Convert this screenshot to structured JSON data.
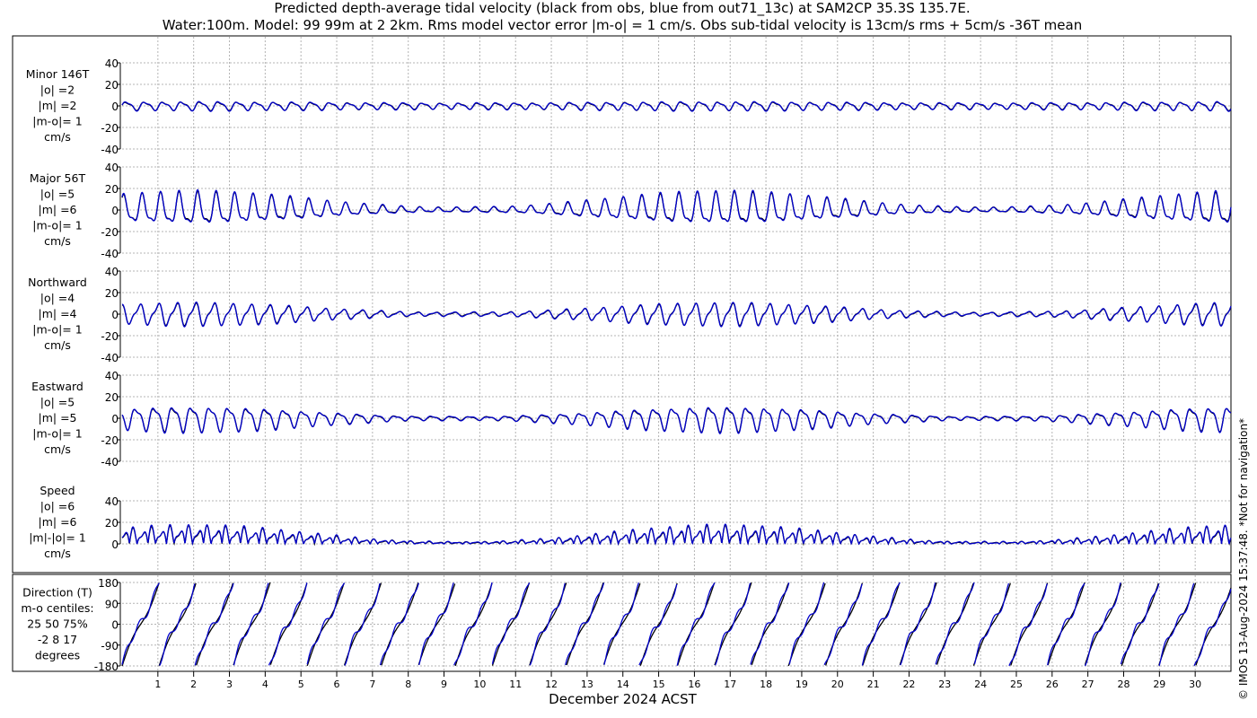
{
  "title_line1": "Predicted depth-average tidal velocity (black from obs, blue from out71_13c) at SAM2CP 35.3S 135.7E.",
  "title_line2": "Water:100m. Model: 99 99m at 2 2km. Rms model vector error |m-o| = 1 cm/s. Obs sub-tidal velocity is 13cm/s rms + 5cm/s -36T mean",
  "side_note": "© IMOS 13-Aug-2024 15:37:48. *Not for navigation*",
  "colors": {
    "obs": "#000000",
    "model": "#0000cc",
    "grid": "#b4b4b4",
    "axis": "#000000"
  },
  "chart_data": [
    {
      "type": "line",
      "id": "minor",
      "label_lines": [
        "Minor 146T",
        "|o| =2",
        "|m| =2",
        "|m-o|= 1",
        "cm/s"
      ],
      "ylim": [
        -40,
        40
      ],
      "yticks": [
        40,
        20,
        0,
        -20,
        -40
      ],
      "series": [
        {
          "name": "black from obs"
        },
        {
          "name": "blue from out71_13c"
        }
      ],
      "amplitude_envelope": [
        2.5,
        3.5
      ],
      "mean": 0
    },
    {
      "type": "line",
      "id": "major",
      "label_lines": [
        "Major 56T",
        "|o| =5",
        "|m| =6",
        "|m-o|= 1",
        "cm/s"
      ],
      "ylim": [
        -40,
        40
      ],
      "yticks": [
        40,
        20,
        0,
        -20,
        -40
      ],
      "series": [
        {
          "name": "black from obs"
        },
        {
          "name": "blue from out71_13c"
        }
      ],
      "amplitude_envelope": [
        2,
        13
      ],
      "mean": 0
    },
    {
      "type": "line",
      "id": "northward",
      "label_lines": [
        "Northward",
        "|o| =4",
        "|m| =4",
        "|m-o|= 1",
        "cm/s"
      ],
      "ylim": [
        -40,
        40
      ],
      "yticks": [
        40,
        20,
        0,
        -20,
        -40
      ],
      "series": [
        {
          "name": "black from obs"
        },
        {
          "name": "blue from out71_13c"
        }
      ],
      "amplitude_envelope": [
        1.5,
        9
      ],
      "mean": 0
    },
    {
      "type": "line",
      "id": "eastward",
      "label_lines": [
        "Eastward",
        "|o| =5",
        "|m| =5",
        "|m-o|= 1",
        "cm/s"
      ],
      "ylim": [
        -40,
        40
      ],
      "yticks": [
        40,
        20,
        0,
        -20,
        -40
      ],
      "series": [
        {
          "name": "black from obs"
        },
        {
          "name": "blue from out71_13c"
        }
      ],
      "amplitude_envelope": [
        1.5,
        10
      ],
      "mean": 0
    },
    {
      "type": "line",
      "id": "speed",
      "label_lines": [
        "Speed",
        "|o| =6",
        "|m| =6",
        "|m|-|o|= 1",
        "cm/s"
      ],
      "ylim": [
        0,
        40
      ],
      "yticks": [
        40,
        20,
        0
      ],
      "series": [
        {
          "name": "black from obs"
        },
        {
          "name": "blue from out71_13c"
        }
      ],
      "amplitude_envelope": [
        1.5,
        13
      ],
      "mean": 0
    },
    {
      "type": "line",
      "id": "direction",
      "label_lines": [
        "Direction (T)",
        "m-o centiles:",
        "25  50  75%",
        "-2   8  17",
        "degrees"
      ],
      "ylim": [
        -180,
        180
      ],
      "yticks": [
        180,
        90,
        0,
        -90,
        -180
      ],
      "series": [
        {
          "name": "black from obs"
        },
        {
          "name": "blue from out71_13c"
        }
      ],
      "wrapped": true
    }
  ],
  "x_axis": {
    "label": "December 2024 ACST",
    "range_days": [
      0,
      31
    ],
    "tick_labels": [
      "1",
      "2",
      "3",
      "4",
      "5",
      "6",
      "7",
      "8",
      "9",
      "10",
      "11",
      "12",
      "13",
      "14",
      "15",
      "16",
      "17",
      "18",
      "19",
      "20",
      "21",
      "22",
      "23",
      "24",
      "25",
      "26",
      "27",
      "28",
      "29",
      "30"
    ],
    "grid": true
  }
}
